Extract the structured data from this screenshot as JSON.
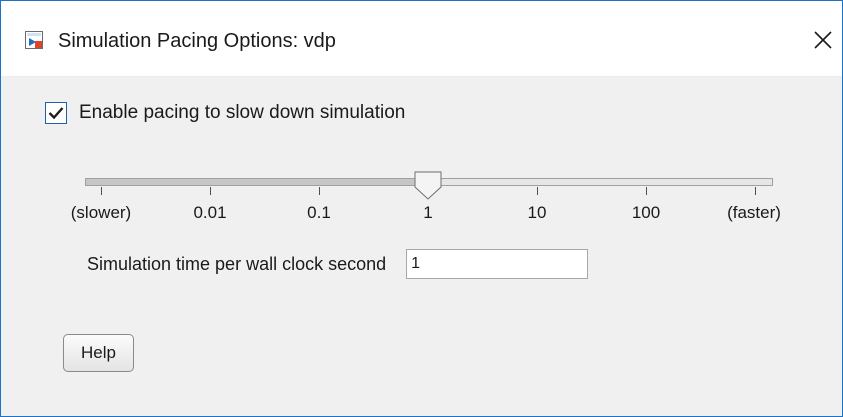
{
  "window": {
    "title": "Simulation Pacing Options: vdp",
    "app_icon": "simulink-model-icon",
    "close_icon": "close-icon",
    "border_color": "#1a73c9"
  },
  "pacing": {
    "checkbox_label": "Enable pacing to slow down simulation",
    "checked": true
  },
  "slider": {
    "tick_labels": [
      "(slower)",
      "0.01",
      "0.1",
      "1",
      "10",
      "100",
      "(faster)"
    ],
    "selected_value": "1",
    "selected_index": 3
  },
  "time_per_second": {
    "label": "Simulation time per wall clock second",
    "value": "1"
  },
  "buttons": {
    "help": "Help"
  }
}
